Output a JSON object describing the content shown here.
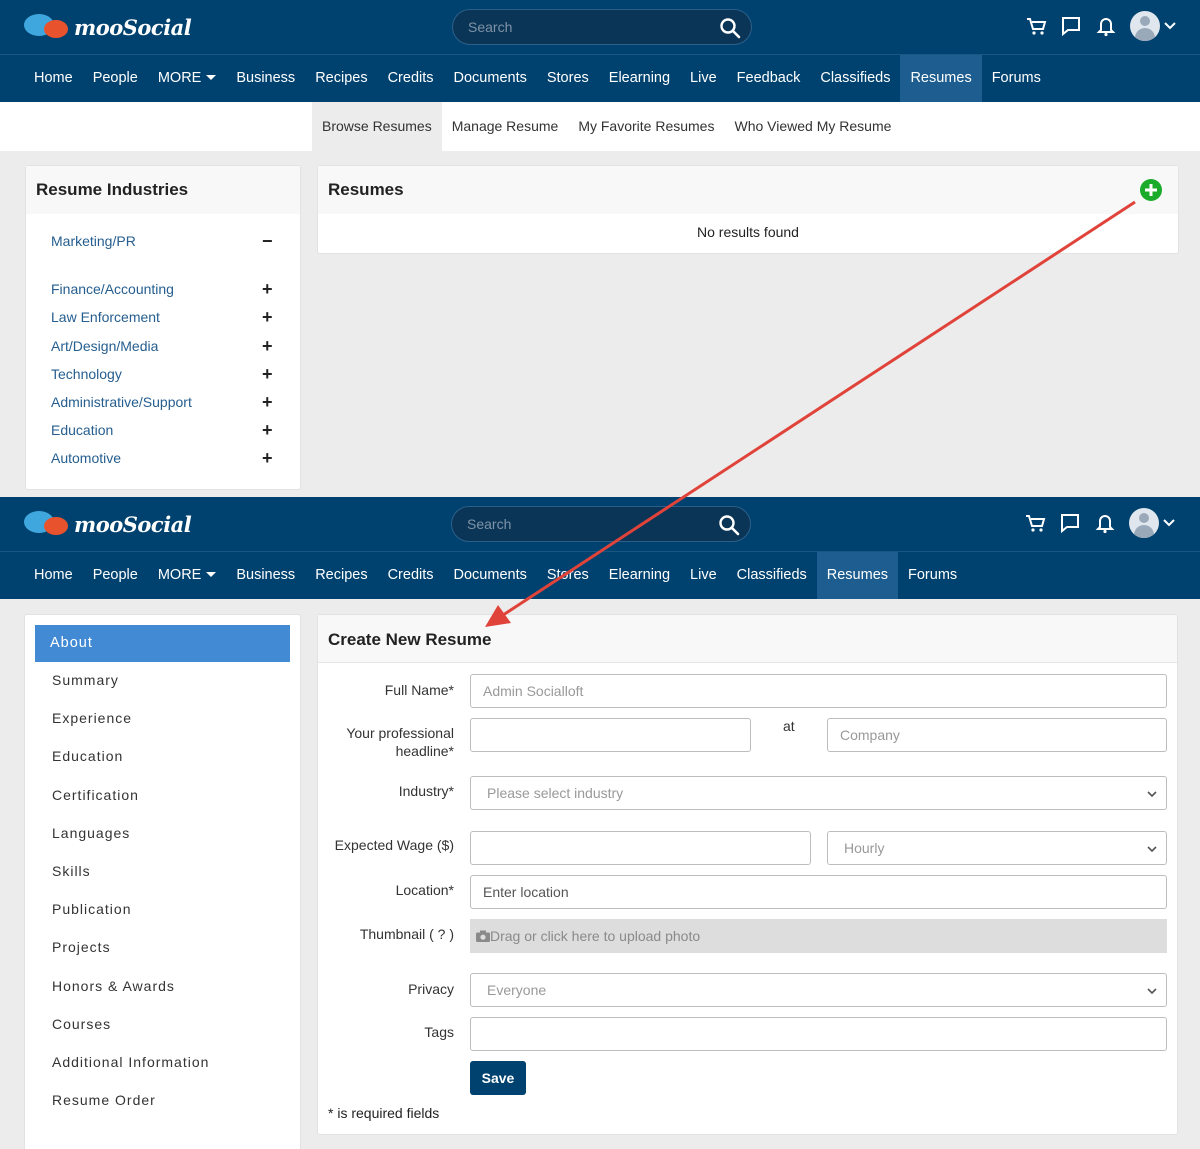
{
  "brand": "mooSocial",
  "search_placeholder": "Search",
  "screen1": {
    "nav": [
      "Home",
      "People",
      "MORE",
      "Business",
      "Recipes",
      "Credits",
      "Documents",
      "Stores",
      "Elearning",
      "Live",
      "Feedback",
      "Classifieds",
      "Resumes",
      "Forums"
    ],
    "active_nav": "Resumes",
    "subnav": [
      "Browse Resumes",
      "Manage Resume",
      "My Favorite Resumes",
      "Who Viewed My Resume"
    ],
    "industries_title": "Resume Industries",
    "industries": [
      {
        "label": "Marketing/PR",
        "toggle": "−"
      },
      {
        "label": "Finance/Accounting",
        "toggle": "+"
      },
      {
        "label": "Law Enforcement",
        "toggle": "+"
      },
      {
        "label": "Art/Design/Media",
        "toggle": "+"
      },
      {
        "label": "Technology",
        "toggle": "+"
      },
      {
        "label": "Administrative/Support",
        "toggle": "+"
      },
      {
        "label": "Education",
        "toggle": "+"
      },
      {
        "label": "Automotive",
        "toggle": "+"
      }
    ],
    "resumes_title": "Resumes",
    "no_results": "No results found"
  },
  "screen2": {
    "nav": [
      "Home",
      "People",
      "MORE",
      "Business",
      "Recipes",
      "Credits",
      "Documents",
      "Stores",
      "Elearning",
      "Live",
      "Classifieds",
      "Resumes",
      "Forums"
    ],
    "active_nav": "Resumes",
    "sidebar": [
      "About",
      "Summary",
      "Experience",
      "Education",
      "Certification",
      "Languages",
      "Skills",
      "Publication",
      "Projects",
      "Honors & Awards",
      "Courses",
      "Additional Information",
      "Resume Order"
    ],
    "form_title": "Create New Resume",
    "fields": {
      "full_name_label": "Full Name*",
      "full_name_value": "Admin Socialloft",
      "headline_label": "Your professional headline*",
      "at_label": "at",
      "company_placeholder": "Company",
      "industry_label": "Industry*",
      "industry_value": "Please select industry",
      "wage_label": "Expected Wage ($)",
      "wage_unit": "Hourly",
      "location_label": "Location*",
      "location_placeholder": "Enter location",
      "thumbnail_label": "Thumbnail ( ? )",
      "upload_text": "Drag or click here to upload photo",
      "privacy_label": "Privacy",
      "privacy_value": "Everyone",
      "tags_label": "Tags",
      "save_label": "Save",
      "required_note": "* is required fields"
    }
  },
  "colors": {
    "header": "#00426f",
    "active_nav": "#1d5d8f",
    "accent": "#438ad5",
    "add": "#1aab2b",
    "arrow": "#e0433a"
  }
}
